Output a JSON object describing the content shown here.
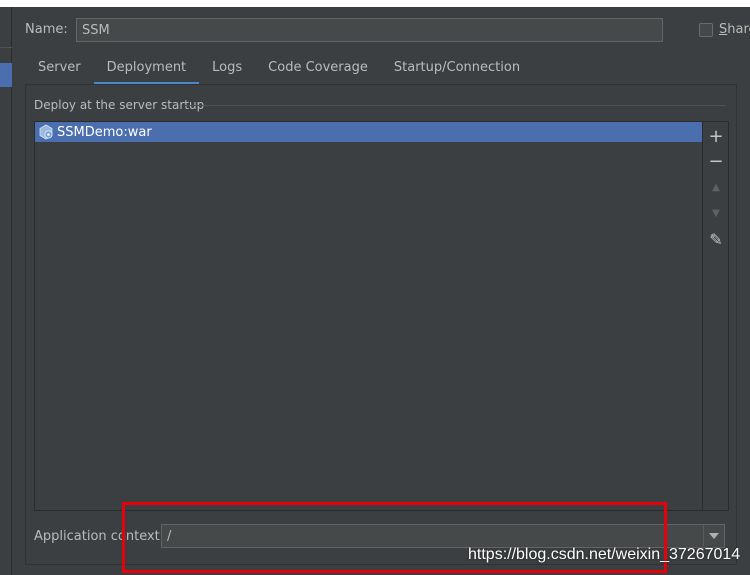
{
  "colors": {
    "background": "#3c3f41",
    "selection": "#4b6eaf",
    "tab_underline": "#4a88c7",
    "annotation": "#e8000b",
    "text": "#bbbbbb"
  },
  "name_field": {
    "label": "Name:",
    "value": "SSM"
  },
  "share": {
    "label_first": "S",
    "label_rest": "hare",
    "checked": false
  },
  "tabs": [
    {
      "label": "Server",
      "active": false
    },
    {
      "label": "Deployment",
      "active": true
    },
    {
      "label": "Logs",
      "active": false
    },
    {
      "label": "Code Coverage",
      "active": false
    },
    {
      "label": "Startup/Connection",
      "active": false
    }
  ],
  "deploy": {
    "group_title": "Deploy at the server startup",
    "items": [
      {
        "label": "SSMDemo:war",
        "icon": "war-artifact-icon",
        "selected": true
      }
    ],
    "toolbar": [
      {
        "name": "add-icon",
        "glyph": "+",
        "enabled": true
      },
      {
        "name": "remove-icon",
        "glyph": "−",
        "enabled": true
      },
      {
        "name": "move-up-icon",
        "glyph": "▲",
        "enabled": false
      },
      {
        "name": "move-down-icon",
        "glyph": "▼",
        "enabled": false
      },
      {
        "name": "edit-icon",
        "glyph": "✎",
        "enabled": true
      }
    ]
  },
  "app_context": {
    "label": "Application context:",
    "value": "/"
  },
  "watermark": "https://blog.csdn.net/weixin_37267014"
}
